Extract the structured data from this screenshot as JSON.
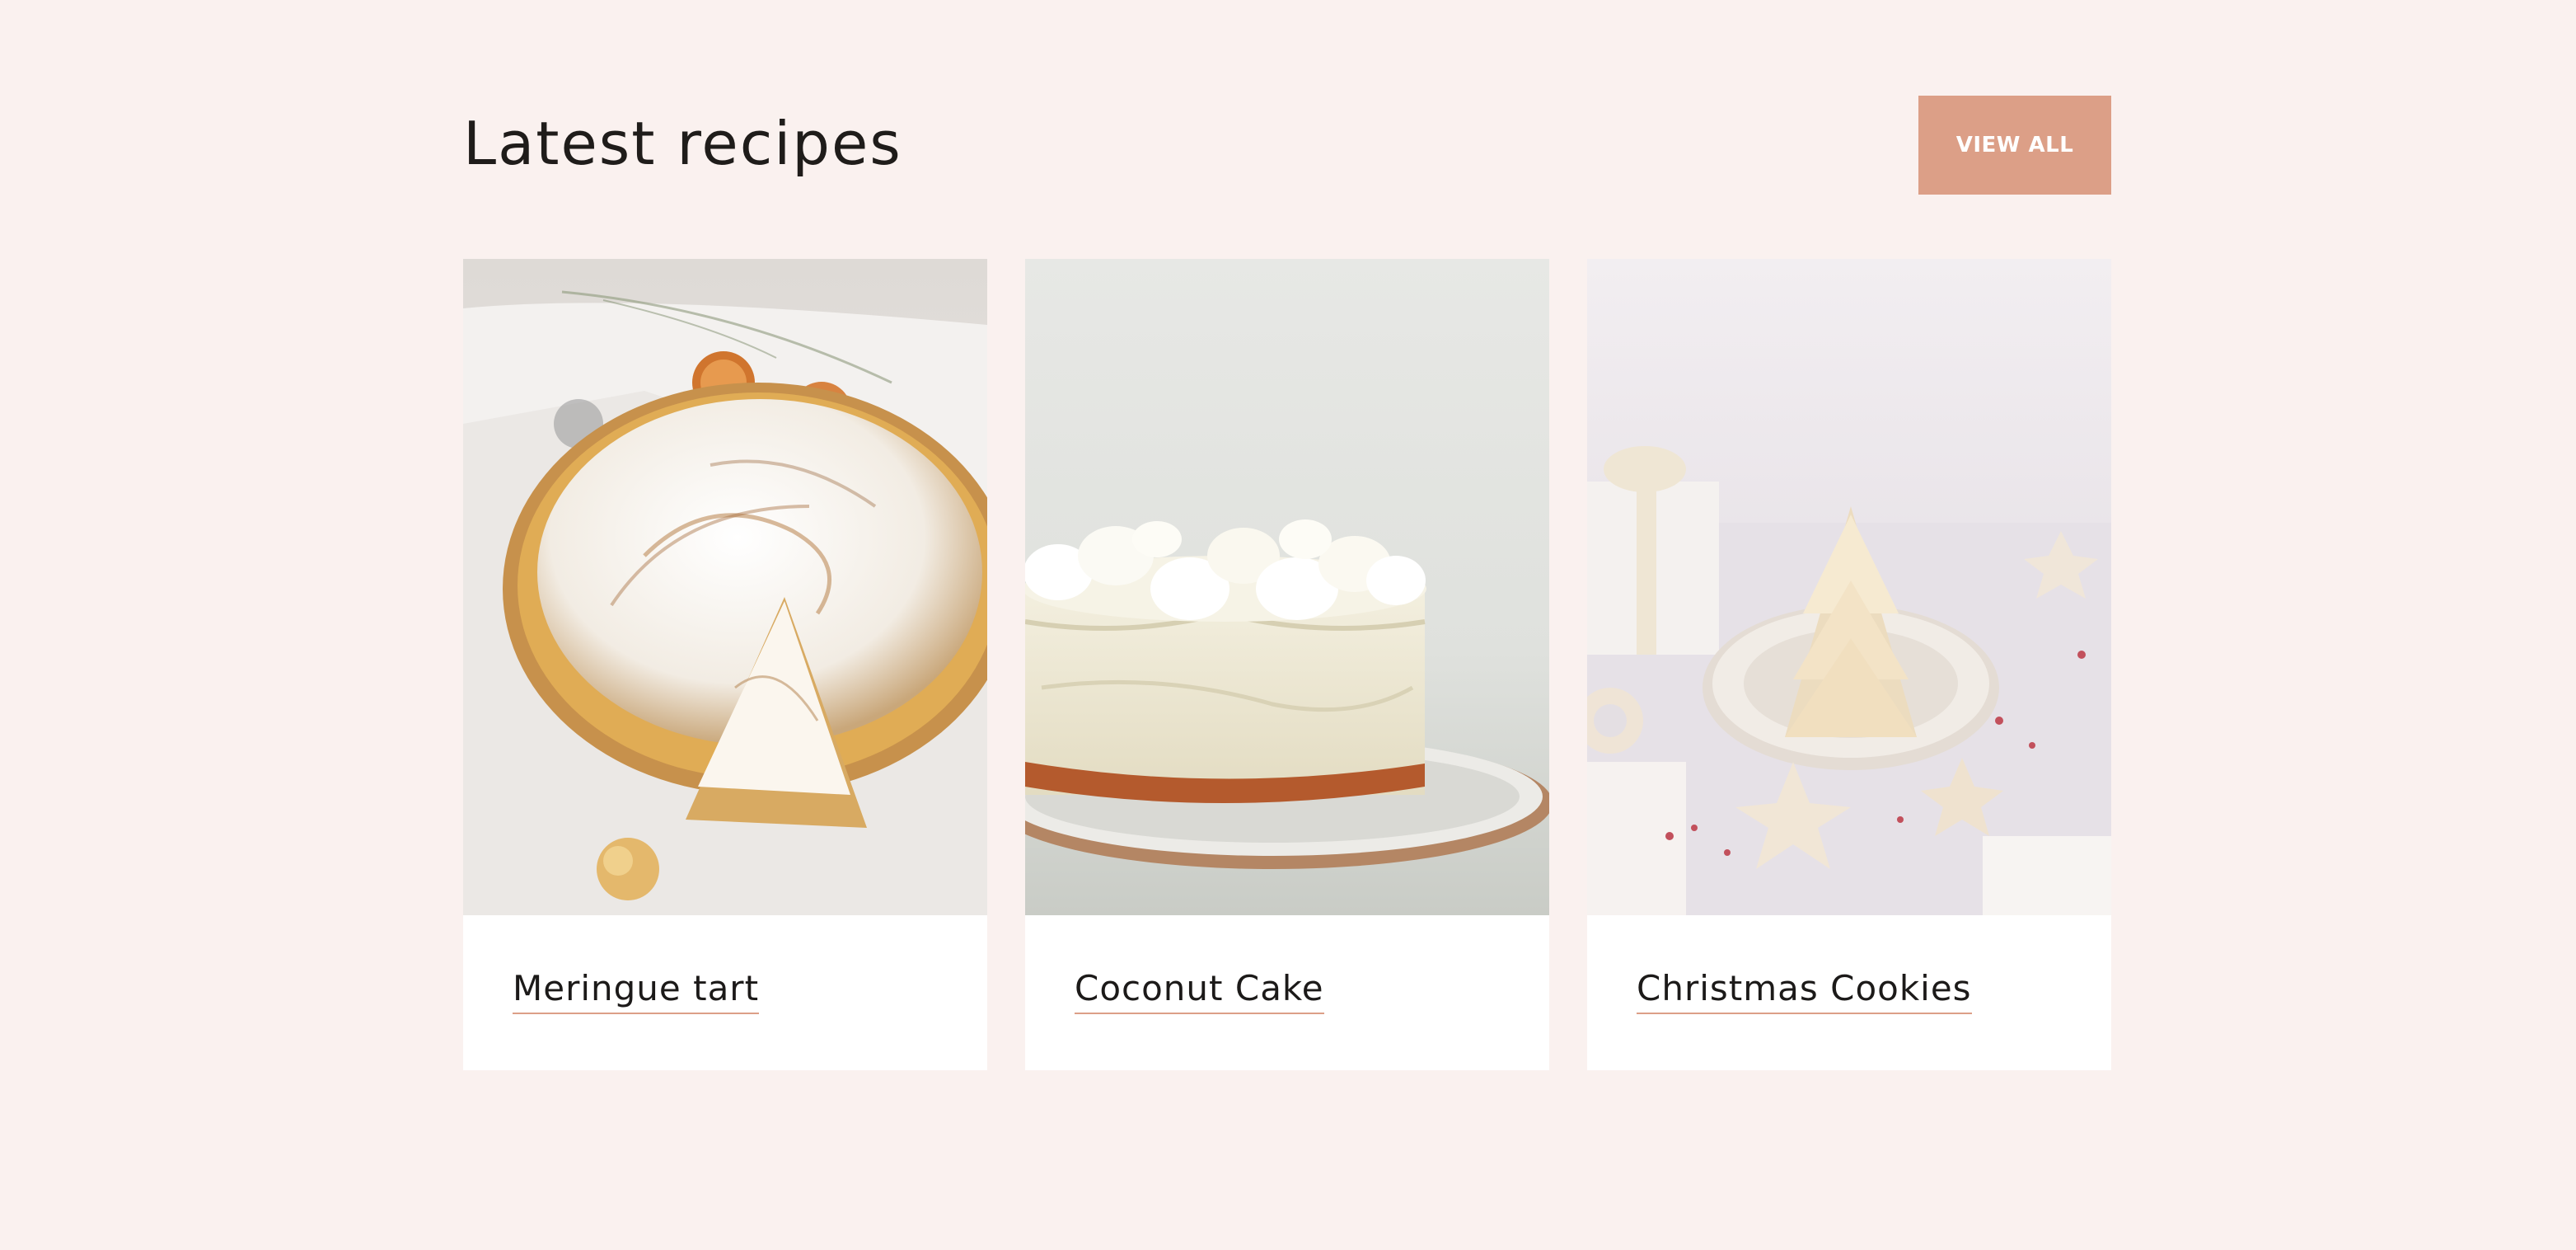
{
  "section": {
    "title": "Latest recipes",
    "view_all_label": "VIEW ALL"
  },
  "colors": {
    "background": "#faf1ef",
    "accent": "#dc9f87",
    "card": "#ffffff",
    "text": "#1f1c1a"
  },
  "recipes": [
    {
      "title": "Meringue tart",
      "image": "meringue-tart-photo"
    },
    {
      "title": "Coconut Cake",
      "image": "coconut-cake-photo"
    },
    {
      "title": "Christmas Cookies",
      "image": "christmas-cookies-photo"
    }
  ]
}
